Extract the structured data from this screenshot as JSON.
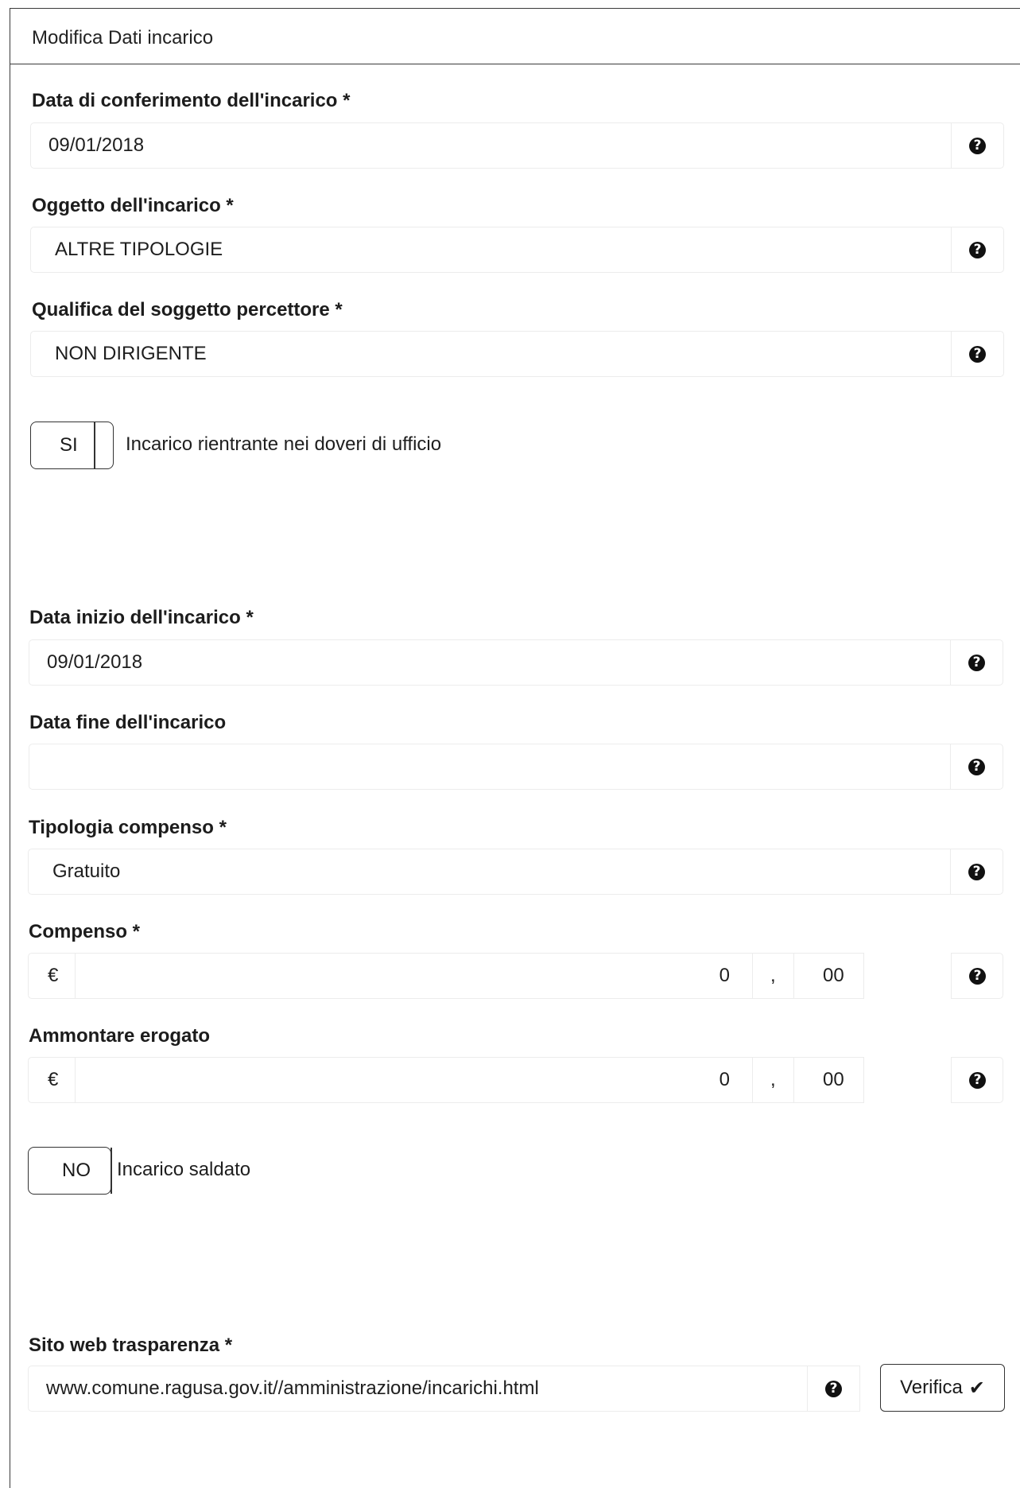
{
  "panel": {
    "title": "Modifica Dati incarico"
  },
  "fields": {
    "data_conferimento": {
      "label": "Data di conferimento dell'incarico *",
      "value": "09/01/2018",
      "help_icon": "question-circle-icon"
    },
    "oggetto": {
      "label": "Oggetto dell'incarico *",
      "value": "ALTRE TIPOLOGIE",
      "help_icon": "question-circle-icon"
    },
    "qualifica": {
      "label": "Qualifica del soggetto percettore *",
      "value": "NON DIRIGENTE",
      "help_icon": "question-circle-icon"
    },
    "doveri_ufficio": {
      "toggle_value": "SI",
      "label": "Incarico rientrante nei doveri di ufficio"
    },
    "data_inizio": {
      "label": "Data inizio dell'incarico *",
      "value": "09/01/2018",
      "help_icon": "question-circle-icon"
    },
    "data_fine": {
      "label": "Data fine dell'incarico",
      "value": "",
      "help_icon": "question-circle-icon"
    },
    "tipologia_compenso": {
      "label": "Tipologia compenso *",
      "value": "Gratuito",
      "help_icon": "question-circle-icon"
    },
    "compenso": {
      "label": "Compenso *",
      "currency": "€",
      "integer": "0",
      "separator": ",",
      "decimals": "00",
      "help_icon": "question-circle-icon"
    },
    "ammontare_erogato": {
      "label": "Ammontare erogato",
      "currency": "€",
      "integer": "0",
      "separator": ",",
      "decimals": "00",
      "help_icon": "question-circle-icon"
    },
    "saldato": {
      "toggle_value": "NO",
      "label": "Incarico saldato"
    },
    "sito_web": {
      "label": "Sito web trasparenza *",
      "value": "www.comune.ragusa.gov.it//amministrazione/incarichi.html",
      "help_icon": "question-circle-icon",
      "verify_label": "Verifica",
      "verify_icon": "check-icon"
    }
  },
  "icons": {
    "help_glyph": "?",
    "check_glyph": "✔"
  }
}
